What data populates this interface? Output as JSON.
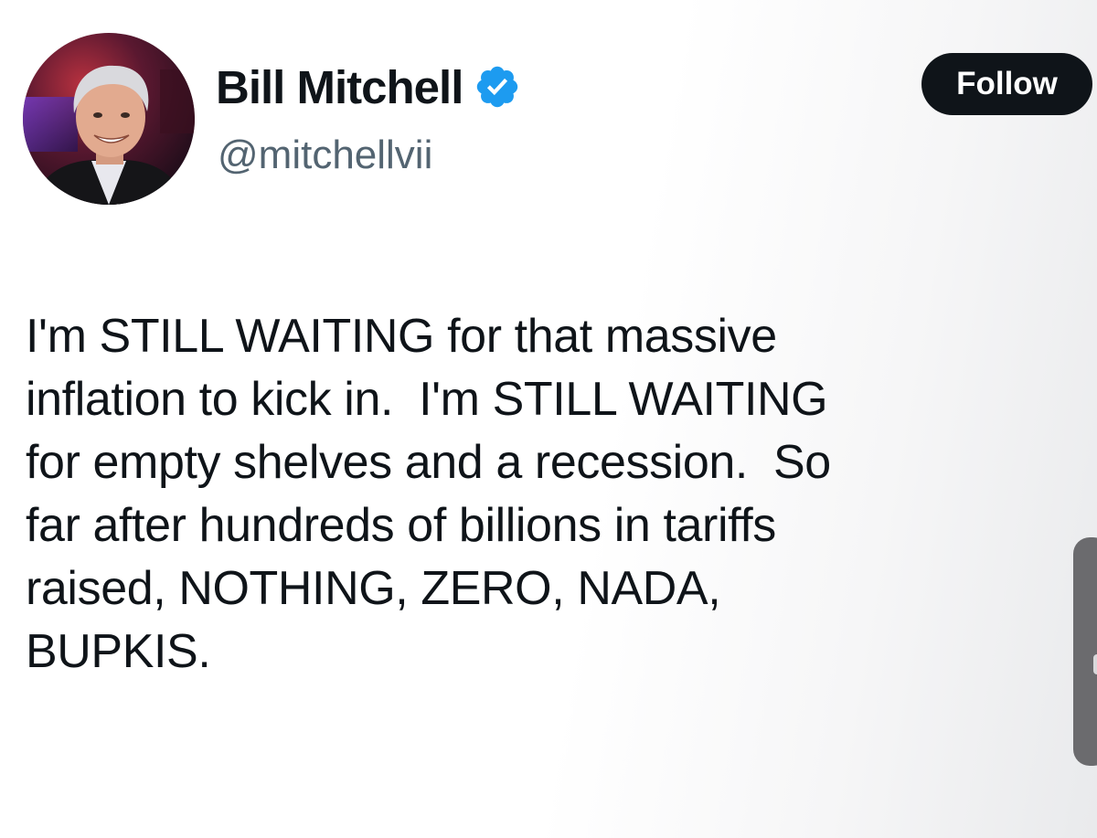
{
  "author": {
    "display_name": "Bill Mitchell",
    "handle": "@mitchellvii",
    "verified": true,
    "verified_icon": "verified-badge-icon",
    "avatar_icon": "profile-photo"
  },
  "actions": {
    "follow_label": "Follow"
  },
  "tweet": {
    "lines": [
      "I'm STILL WAITING for that massive",
      "inflation to kick in.  I'm STILL WAITING",
      "for empty shelves and a recession.  So",
      "far after hundreds of billions in tariffs",
      "raised, NOTHING, ZERO, NADA,",
      "BUPKIS."
    ]
  },
  "colors": {
    "text": "#0f1419",
    "secondary_text": "#536471",
    "verified_blue": "#1d9bf0",
    "button_bg": "#0f1419",
    "button_text": "#ffffff"
  }
}
